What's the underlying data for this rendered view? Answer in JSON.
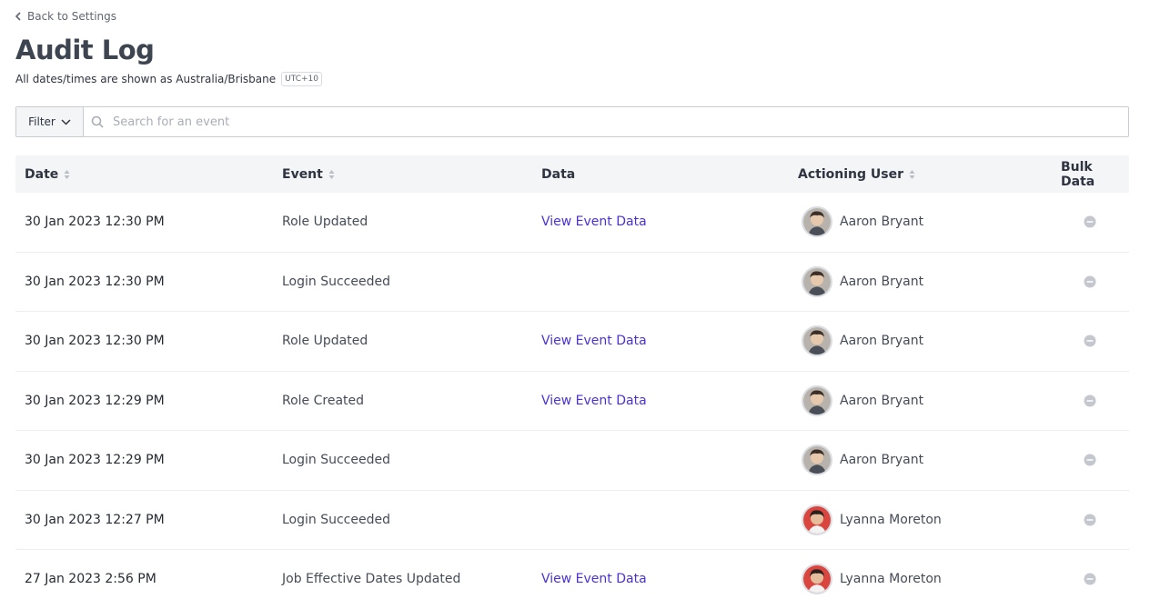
{
  "header": {
    "back_link_label": "Back to Settings",
    "title": "Audit Log",
    "timezone_note": "All dates/times are shown as Australia/Brisbane",
    "timezone_badge": "UTC+10"
  },
  "filter_bar": {
    "filter_label": "Filter",
    "search_placeholder": "Search for an event",
    "search_value": ""
  },
  "table": {
    "columns": {
      "date": "Date",
      "event": "Event",
      "data": "Data",
      "actioning_user": "Actioning User",
      "bulk_data": "Bulk Data"
    },
    "rows": [
      {
        "date": "30 Jan 2023 12:30 PM",
        "event": "Role Updated",
        "data": "View Event Data",
        "user": "Aaron Bryant"
      },
      {
        "date": "30 Jan 2023 12:30 PM",
        "event": "Login Succeeded",
        "data": "",
        "user": "Aaron Bryant"
      },
      {
        "date": "30 Jan 2023 12:30 PM",
        "event": "Role Updated",
        "data": "View Event Data",
        "user": "Aaron Bryant"
      },
      {
        "date": "30 Jan 2023 12:29 PM",
        "event": "Role Created",
        "data": "View Event Data",
        "user": "Aaron Bryant"
      },
      {
        "date": "30 Jan 2023 12:29 PM",
        "event": "Login Succeeded",
        "data": "",
        "user": "Aaron Bryant"
      },
      {
        "date": "30 Jan 2023 12:27 PM",
        "event": "Login Succeeded",
        "data": "",
        "user": "Lyanna Moreton"
      },
      {
        "date": "27 Jan 2023 2:56 PM",
        "event": "Job Effective Dates Updated",
        "data": "View Event Data",
        "user": "Lyanna Moreton"
      }
    ]
  },
  "colors": {
    "link": "#4a32d6",
    "header_bg": "#f3f5f7",
    "title": "#3d4550",
    "bulk_icon": "#c4c8ce"
  },
  "icons": {
    "back": "chevron-left-icon",
    "filter_dropdown": "chevron-down-icon",
    "search": "search-icon",
    "sort": "sort-icon",
    "bulk": "minus-circle-icon"
  }
}
